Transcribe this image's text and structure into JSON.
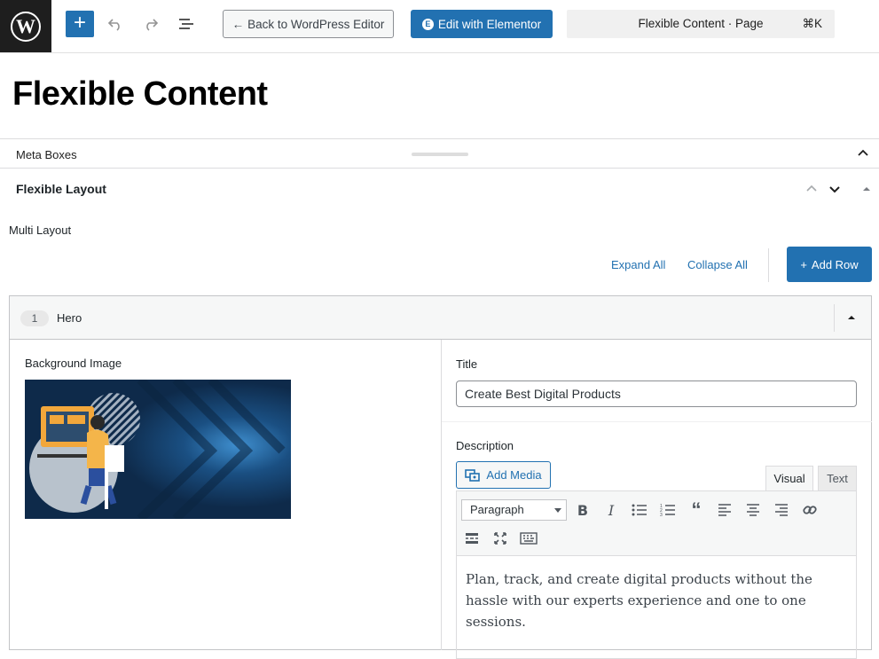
{
  "topbar": {
    "back_label": "Back to WordPress Editor",
    "elementor_label": "Edit with Elementor",
    "command": {
      "title": "Flexible Content · Page",
      "shortcut": "⌘K"
    }
  },
  "page": {
    "title": "Flexible Content"
  },
  "meta_boxes": {
    "label": "Meta Boxes"
  },
  "flexible": {
    "title": "Flexible Layout",
    "multi_label": "Multi Layout",
    "expand_all": "Expand All",
    "collapse_all": "Collapse All",
    "add_row": "Add Row"
  },
  "row": {
    "number": "1",
    "name": "Hero",
    "bg_label": "Background Image",
    "title_label": "Title",
    "title_value": "Create Best Digital Products",
    "desc_label": "Description",
    "add_media": "Add Media",
    "tabs": {
      "visual": "Visual",
      "text": "Text"
    },
    "format": "Paragraph",
    "content": "Plan, track, and create digital products without the hassle with our experts experience and one to one sessions."
  },
  "colors": {
    "primary": "#2271b1",
    "dark": "#1e1e1e"
  }
}
